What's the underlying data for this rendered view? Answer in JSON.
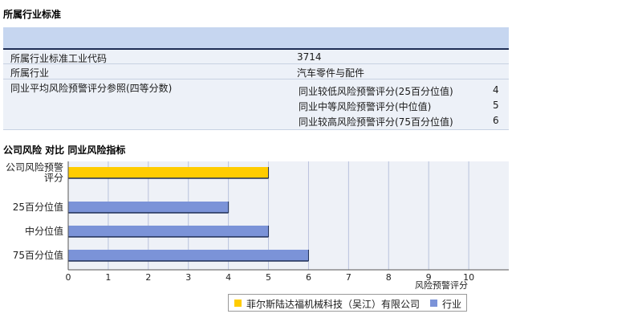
{
  "section1_title": "所属行业标准",
  "info": {
    "sic_label": "所属行业标准工业代码",
    "sic_value": "3714",
    "industry_label": "所属行业",
    "industry_value": "汽车零件与配件",
    "avg_label": "同业平均风险预警评分参照(四等分数)",
    "percentiles": [
      {
        "label": "同业较低风险预警评分(25百分位值)",
        "value": "4"
      },
      {
        "label": "同业中等风险预警评分(中位值)",
        "value": "5"
      },
      {
        "label": "同业较高风险预警评分(75百分位值)",
        "value": "6"
      }
    ]
  },
  "section2_title": "公司风险  对比  同业风险指标",
  "colors": {
    "company": "#ffcc00",
    "industry": "#7b93d8",
    "plot_bg": "#eef1f7",
    "grid": "#b9c2dc"
  },
  "chart_data": {
    "type": "bar",
    "orientation": "horizontal",
    "categories": [
      "公司风险预警评分",
      "25百分位值",
      "中分位值",
      "75百分位值"
    ],
    "category_lines": [
      [
        "公司风险预警",
        "评分"
      ],
      [
        "25百分位值"
      ],
      [
        "中分位值"
      ],
      [
        "75百分位值"
      ]
    ],
    "values": [
      5,
      4,
      5,
      6
    ],
    "bar_series": [
      "company",
      "industry",
      "industry",
      "industry"
    ],
    "series": [
      {
        "name": "菲尔斯陆达福机械科技（吴江）有限公司",
        "color": "#ffcc00"
      },
      {
        "name": "行业",
        "color": "#7b93d8"
      }
    ],
    "xlabel": "风险预警评分",
    "xlim": [
      0,
      11
    ],
    "xticks": [
      0,
      1,
      2,
      3,
      4,
      5,
      6,
      7,
      8,
      9,
      10
    ],
    "grid": true,
    "legend_position": "bottom"
  }
}
